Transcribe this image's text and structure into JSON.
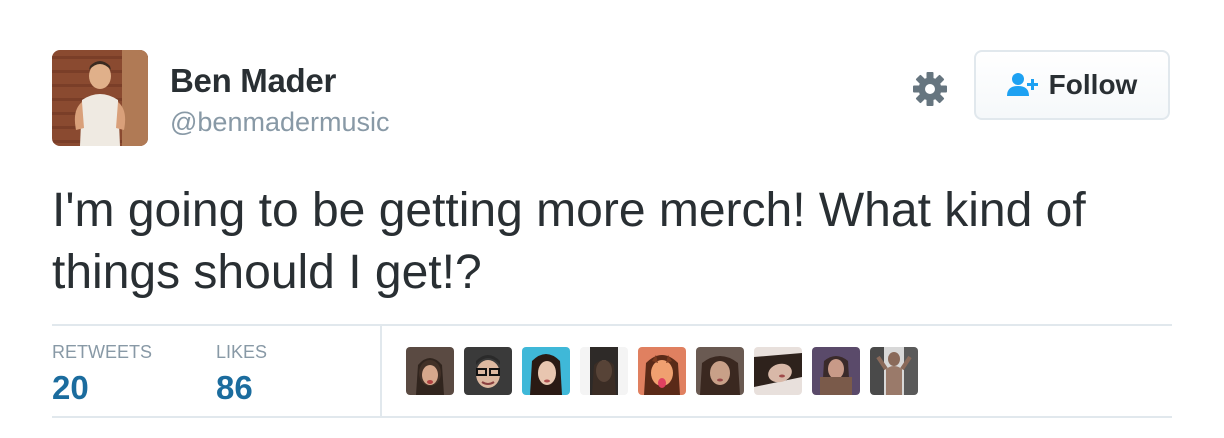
{
  "user": {
    "display_name": "Ben Mader",
    "handle": "@benmadermusic"
  },
  "actions": {
    "follow_label": "Follow",
    "settings_icon": "gear-icon",
    "follow_icon": "user-plus-icon"
  },
  "tweet": {
    "text": "I'm going to be getting more merch! What kind of things should I get!?"
  },
  "stats": {
    "retweets_label": "RETWEETS",
    "retweets_count": "20",
    "likes_label": "LIKES",
    "likes_count": "86"
  },
  "colors": {
    "text_primary": "#292f33",
    "text_secondary": "#8899a6",
    "stat_value": "#1b6c9e",
    "follow_icon": "#1da1f2",
    "divider": "#e1e8ed"
  }
}
